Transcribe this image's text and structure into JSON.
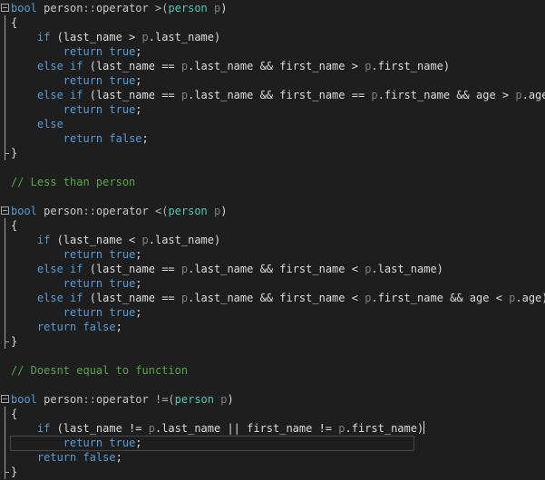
{
  "editor": {
    "theme": {
      "background": "#1e1e1e",
      "keyword": "#569cd6",
      "type": "#4ec9b0",
      "parameter": "#7f7f7f",
      "comment": "#57a64a",
      "text": "#dcdcdc"
    },
    "current_line": 30,
    "lines": [
      {
        "fold": true,
        "tokens": [
          {
            "t": "bool",
            "c": "kw"
          },
          {
            "t": " "
          },
          {
            "t": "person",
            "c": "func"
          },
          {
            "t": "::",
            "c": "op"
          },
          {
            "t": "operator",
            "c": "func"
          },
          {
            "t": " >(",
            "c": "op"
          },
          {
            "t": "person",
            "c": "type"
          },
          {
            "t": " "
          },
          {
            "t": "p",
            "c": "param"
          },
          {
            "t": ")"
          }
        ]
      },
      {
        "guide": true,
        "tokens": [
          {
            "t": "{"
          }
        ]
      },
      {
        "guide": true,
        "tokens": [
          {
            "t": "    "
          },
          {
            "t": "if",
            "c": "kw"
          },
          {
            "t": " (last_name > "
          },
          {
            "t": "p",
            "c": "param"
          },
          {
            "t": ".last_name)"
          }
        ]
      },
      {
        "guide": true,
        "tokens": [
          {
            "t": "        "
          },
          {
            "t": "return",
            "c": "kw"
          },
          {
            "t": " "
          },
          {
            "t": "true",
            "c": "kw"
          },
          {
            "t": ";"
          }
        ]
      },
      {
        "guide": true,
        "tokens": [
          {
            "t": "    "
          },
          {
            "t": "else",
            "c": "kw"
          },
          {
            "t": " "
          },
          {
            "t": "if",
            "c": "kw"
          },
          {
            "t": " (last_name == "
          },
          {
            "t": "p",
            "c": "param"
          },
          {
            "t": ".last_name && first_name > "
          },
          {
            "t": "p",
            "c": "param"
          },
          {
            "t": ".first_name)"
          }
        ]
      },
      {
        "guide": true,
        "tokens": [
          {
            "t": "        "
          },
          {
            "t": "return",
            "c": "kw"
          },
          {
            "t": " "
          },
          {
            "t": "true",
            "c": "kw"
          },
          {
            "t": ";"
          }
        ]
      },
      {
        "guide": true,
        "tokens": [
          {
            "t": "    "
          },
          {
            "t": "else",
            "c": "kw"
          },
          {
            "t": " "
          },
          {
            "t": "if",
            "c": "kw"
          },
          {
            "t": " (last_name == "
          },
          {
            "t": "p",
            "c": "param"
          },
          {
            "t": ".last_name && first_name == "
          },
          {
            "t": "p",
            "c": "param"
          },
          {
            "t": ".first_name && age > "
          },
          {
            "t": "p",
            "c": "param"
          },
          {
            "t": ".age)"
          }
        ]
      },
      {
        "guide": true,
        "tokens": [
          {
            "t": "        "
          },
          {
            "t": "return",
            "c": "kw"
          },
          {
            "t": " "
          },
          {
            "t": "true",
            "c": "kw"
          },
          {
            "t": ";"
          }
        ]
      },
      {
        "guide": true,
        "tokens": [
          {
            "t": "    "
          },
          {
            "t": "else",
            "c": "kw"
          }
        ]
      },
      {
        "guide": true,
        "tokens": [
          {
            "t": "        "
          },
          {
            "t": "return",
            "c": "kw"
          },
          {
            "t": " "
          },
          {
            "t": "false",
            "c": "kw"
          },
          {
            "t": ";"
          }
        ]
      },
      {
        "guide": "end",
        "tokens": [
          {
            "t": "}"
          }
        ]
      },
      {
        "tokens": []
      },
      {
        "tokens": [
          {
            "t": "// Less than person",
            "c": "comment"
          }
        ]
      },
      {
        "tokens": []
      },
      {
        "fold": true,
        "tokens": [
          {
            "t": "bool",
            "c": "kw"
          },
          {
            "t": " "
          },
          {
            "t": "person",
            "c": "func"
          },
          {
            "t": "::",
            "c": "op"
          },
          {
            "t": "operator",
            "c": "func"
          },
          {
            "t": " <(",
            "c": "op"
          },
          {
            "t": "person",
            "c": "type"
          },
          {
            "t": " "
          },
          {
            "t": "p",
            "c": "param"
          },
          {
            "t": ")"
          }
        ]
      },
      {
        "guide": true,
        "tokens": [
          {
            "t": "{"
          }
        ]
      },
      {
        "guide": true,
        "tokens": [
          {
            "t": "    "
          },
          {
            "t": "if",
            "c": "kw"
          },
          {
            "t": " (last_name < "
          },
          {
            "t": "p",
            "c": "param"
          },
          {
            "t": ".last_name)"
          }
        ]
      },
      {
        "guide": true,
        "tokens": [
          {
            "t": "        "
          },
          {
            "t": "return",
            "c": "kw"
          },
          {
            "t": " "
          },
          {
            "t": "true",
            "c": "kw"
          },
          {
            "t": ";"
          }
        ]
      },
      {
        "guide": true,
        "tokens": [
          {
            "t": "    "
          },
          {
            "t": "else",
            "c": "kw"
          },
          {
            "t": " "
          },
          {
            "t": "if",
            "c": "kw"
          },
          {
            "t": " (last_name == "
          },
          {
            "t": "p",
            "c": "param"
          },
          {
            "t": ".last_name && first_name < "
          },
          {
            "t": "p",
            "c": "param"
          },
          {
            "t": ".last_name)"
          }
        ]
      },
      {
        "guide": true,
        "tokens": [
          {
            "t": "        "
          },
          {
            "t": "return",
            "c": "kw"
          },
          {
            "t": " "
          },
          {
            "t": "true",
            "c": "kw"
          },
          {
            "t": ";"
          }
        ]
      },
      {
        "guide": true,
        "tokens": [
          {
            "t": "    "
          },
          {
            "t": "else",
            "c": "kw"
          },
          {
            "t": " "
          },
          {
            "t": "if",
            "c": "kw"
          },
          {
            "t": " (last_name == "
          },
          {
            "t": "p",
            "c": "param"
          },
          {
            "t": ".last_name && first_name < "
          },
          {
            "t": "p",
            "c": "param"
          },
          {
            "t": ".first_name && age < "
          },
          {
            "t": "p",
            "c": "param"
          },
          {
            "t": ".age)"
          }
        ]
      },
      {
        "guide": true,
        "tokens": [
          {
            "t": "        "
          },
          {
            "t": "return",
            "c": "kw"
          },
          {
            "t": " "
          },
          {
            "t": "true",
            "c": "kw"
          },
          {
            "t": ";"
          }
        ]
      },
      {
        "guide": true,
        "tokens": [
          {
            "t": "    "
          },
          {
            "t": "return",
            "c": "kw"
          },
          {
            "t": " "
          },
          {
            "t": "false",
            "c": "kw"
          },
          {
            "t": ";"
          }
        ]
      },
      {
        "guide": "end",
        "tokens": [
          {
            "t": "}"
          }
        ]
      },
      {
        "tokens": []
      },
      {
        "tokens": [
          {
            "t": "// Doesnt equal to function",
            "c": "comment"
          }
        ]
      },
      {
        "tokens": []
      },
      {
        "fold": true,
        "tokens": [
          {
            "t": "bool",
            "c": "kw"
          },
          {
            "t": " "
          },
          {
            "t": "person",
            "c": "func"
          },
          {
            "t": "::",
            "c": "op"
          },
          {
            "t": "operator",
            "c": "func"
          },
          {
            "t": " !=(",
            "c": "op"
          },
          {
            "t": "person",
            "c": "type"
          },
          {
            "t": " "
          },
          {
            "t": "p",
            "c": "param"
          },
          {
            "t": ")"
          }
        ]
      },
      {
        "guide": true,
        "tokens": [
          {
            "t": "{"
          }
        ]
      },
      {
        "guide": true,
        "caret": true,
        "tokens": [
          {
            "t": "    "
          },
          {
            "t": "if",
            "c": "kw"
          },
          {
            "t": " (last_name != "
          },
          {
            "t": "p",
            "c": "param"
          },
          {
            "t": ".last_name || first_name != "
          },
          {
            "t": "p",
            "c": "param"
          },
          {
            "t": ".first_name)"
          }
        ]
      },
      {
        "guide": true,
        "tokens": [
          {
            "t": "        "
          },
          {
            "t": "return",
            "c": "kw"
          },
          {
            "t": " "
          },
          {
            "t": "true",
            "c": "kw"
          },
          {
            "t": ";"
          }
        ]
      },
      {
        "guide": true,
        "tokens": [
          {
            "t": "    "
          },
          {
            "t": "return",
            "c": "kw"
          },
          {
            "t": " "
          },
          {
            "t": "false",
            "c": "kw"
          },
          {
            "t": ";"
          }
        ]
      },
      {
        "guide": "end",
        "tokens": [
          {
            "t": "}"
          }
        ]
      }
    ]
  }
}
